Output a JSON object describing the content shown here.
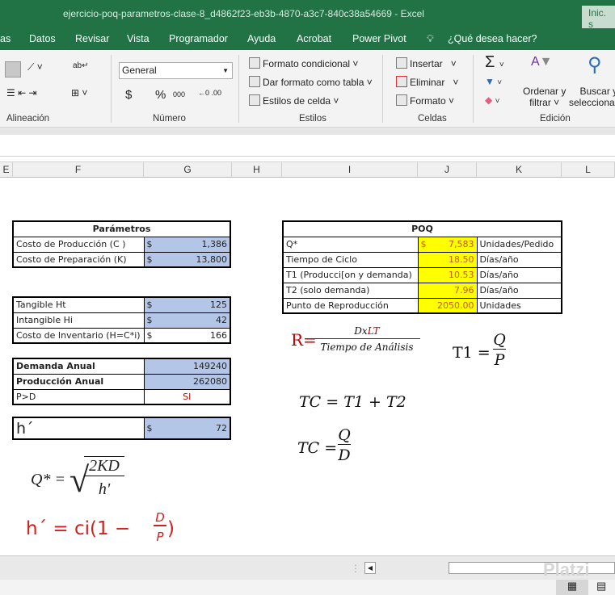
{
  "window": {
    "title": "ejercicio-poq-parametros-clase-8_d4862f23-eb3b-4870-a3c7-840c38a54669  -  Excel",
    "signin": "Inic. s"
  },
  "tabs": [
    "as",
    "Datos",
    "Revisar",
    "Vista",
    "Programador",
    "Ayuda",
    "Acrobat",
    "Power Pivot"
  ],
  "tell_me": "¿Qué desea hacer?",
  "ribbon": {
    "alineacion": "Alineación",
    "numero": "Número",
    "estilos": "Estilos",
    "celdas": "Celdas",
    "edicion": "Edición",
    "number_format": "General",
    "currency": "$",
    "percent": "%",
    "thousands": "000",
    "formato_condicional": "Formato condicional",
    "dar_formato": "Dar formato como tabla",
    "estilos_celda": "Estilos de celda",
    "insertar": "Insertar",
    "eliminar": "Eliminar",
    "formato": "Formato",
    "ordenar": "Ordenar y",
    "filtrar": "filtrar",
    "buscar": "Buscar y",
    "seleccionar": "seleccionar"
  },
  "columns": [
    "E",
    "F",
    "G",
    "H",
    "I",
    "J",
    "K",
    "L"
  ],
  "parametros": {
    "title": "Parámetros",
    "rows": [
      {
        "label": "Costo de Producción (C )",
        "cur": "$",
        "value": "1,386"
      },
      {
        "label": "Costo de Preparación (K)",
        "cur": "$",
        "value": "13,800"
      }
    ]
  },
  "inventario": [
    {
      "label": "Tangible Ht",
      "cur": "$",
      "value": "125"
    },
    {
      "label": "Intangible Hi",
      "cur": "$",
      "value": "42"
    },
    {
      "label": "Costo de Inventario (H=C*i)",
      "cur": "$",
      "value": "166"
    }
  ],
  "demanda": [
    {
      "label": "Demanda Anual",
      "value": "149240"
    },
    {
      "label": "Producción Anual",
      "value": "262080"
    },
    {
      "label": "P>D",
      "value": "SI"
    }
  ],
  "hprime": {
    "label": "h´",
    "cur": "$",
    "value": "72"
  },
  "poq": {
    "title": "POQ",
    "rows": [
      {
        "label": "Q*",
        "cur": "$",
        "value": "7,583",
        "unit": "Unidades/Pedido"
      },
      {
        "label": "Tiempo de Ciclo",
        "value": "18.50",
        "unit": "Días/año"
      },
      {
        "label": "T1 (Producci[on y demanda)",
        "value": "10.53",
        "unit": "Días/año"
      },
      {
        "label": "T2 (solo demanda)",
        "value": "7.96",
        "unit": "Días/año"
      },
      {
        "label": "Punto de Reproducción",
        "value": "2050.00",
        "unit": "Unidades"
      }
    ]
  },
  "formulas": {
    "r_lhs": "R=",
    "r_num_a": "Dx",
    "r_num_b": "LT",
    "r_den": "Tiempo de Análisis",
    "t1_lhs": "T1 =",
    "t1_num": "Q",
    "t1_den": "P",
    "tc1": "TC = T1 + T2",
    "tc2_lhs": "TC =",
    "tc2_num": "Q",
    "tc2_den": "D",
    "q_lhs": "Q* =",
    "q_num": "2KD",
    "q_den": "h'",
    "h_lhs": "h´ = ci(1 −",
    "h_num": "D",
    "h_den": "P",
    "h_close": ")"
  },
  "watermark": "Platzi"
}
